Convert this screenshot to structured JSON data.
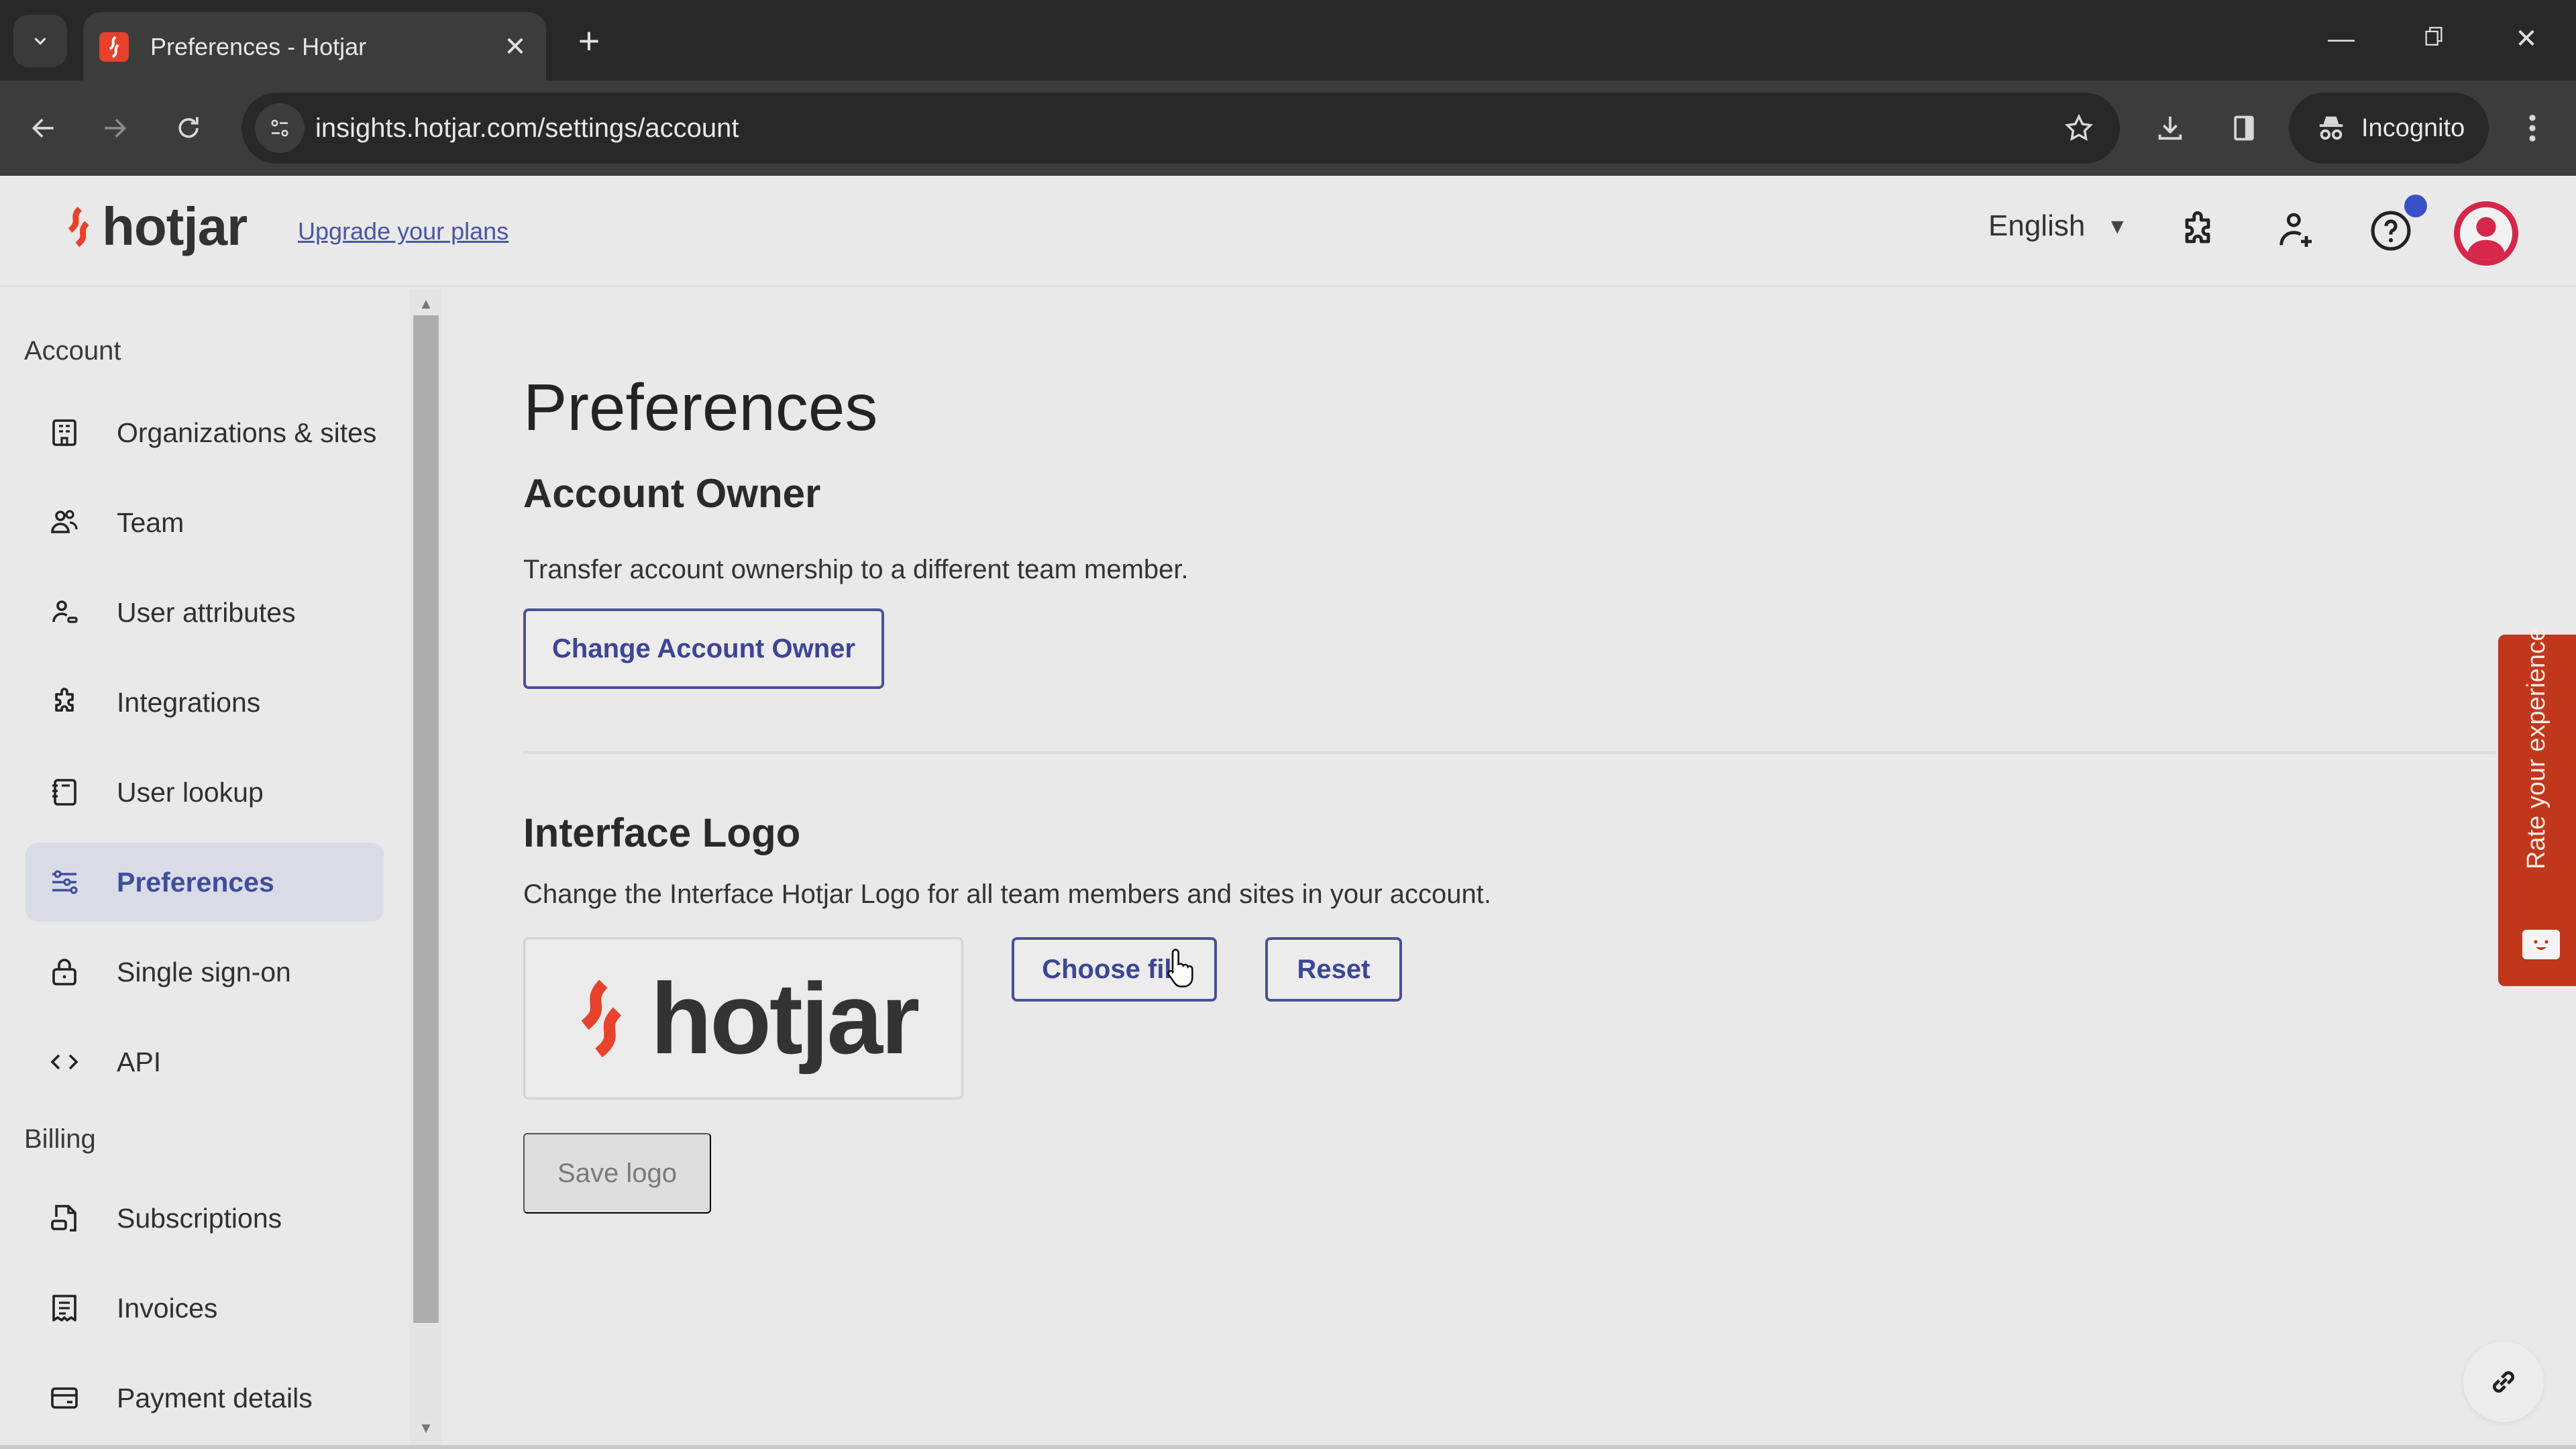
{
  "browser": {
    "tab_title": "Preferences - Hotjar",
    "url": "insights.hotjar.com/settings/account",
    "incognito_label": "Incognito"
  },
  "header": {
    "logo_text": "hotjar",
    "upgrade_link": "Upgrade your plans",
    "language": "English",
    "brand_color": "#e8412c",
    "notification_dot_color": "#3a50c8",
    "avatar_color": "#d6264a"
  },
  "sidebar": {
    "sections": [
      {
        "title": "Account",
        "items": [
          {
            "label": "Organizations & sites",
            "icon": "building-icon"
          },
          {
            "label": "Team",
            "icon": "team-icon"
          },
          {
            "label": "User attributes",
            "icon": "user-attributes-icon"
          },
          {
            "label": "Integrations",
            "icon": "puzzle-icon"
          },
          {
            "label": "User lookup",
            "icon": "notebook-icon"
          },
          {
            "label": "Preferences",
            "icon": "sliders-icon",
            "active": true
          },
          {
            "label": "Single sign-on",
            "icon": "lock-icon"
          },
          {
            "label": "API",
            "icon": "code-icon"
          }
        ]
      },
      {
        "title": "Billing",
        "items": [
          {
            "label": "Subscriptions",
            "icon": "subscription-icon"
          },
          {
            "label": "Invoices",
            "icon": "receipt-icon"
          },
          {
            "label": "Payment details",
            "icon": "credit-card-icon"
          }
        ]
      }
    ]
  },
  "main": {
    "page_title": "Preferences",
    "account_owner": {
      "title": "Account Owner",
      "description": "Transfer account ownership to a different team member.",
      "button": "Change Account Owner"
    },
    "interface_logo": {
      "title": "Interface Logo",
      "description": "Change the Interface Hotjar Logo for all team members and sites in your account.",
      "preview_text": "hotjar",
      "choose_button": "Choose file",
      "reset_button": "Reset",
      "save_button": "Save logo"
    }
  },
  "feedback_tab": {
    "label": "Rate your experience",
    "color": "#c0371b"
  }
}
